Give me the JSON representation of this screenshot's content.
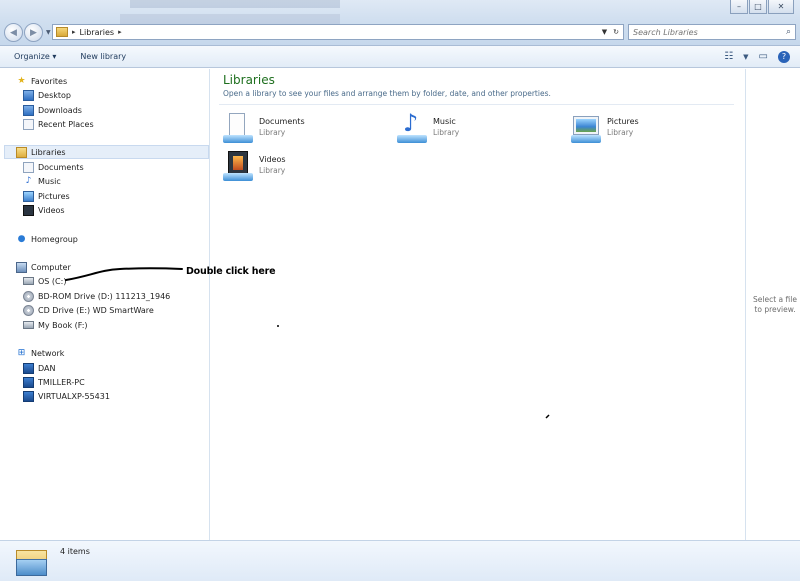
{
  "address_bar": {
    "breadcrumb": [
      "Libraries"
    ],
    "search_placeholder": "Search Libraries"
  },
  "toolbar": {
    "organize_label": "Organize",
    "new_library_label": "New library"
  },
  "navigation": {
    "favorites": {
      "label": "Favorites",
      "items": [
        "Desktop",
        "Downloads",
        "Recent Places"
      ]
    },
    "libraries": {
      "label": "Libraries",
      "items": [
        "Documents",
        "Music",
        "Pictures",
        "Videos"
      ]
    },
    "homegroup": {
      "label": "Homegroup"
    },
    "computer": {
      "label": "Computer",
      "items": [
        "OS (C:)",
        "BD-ROM Drive (D:) 111213_1946",
        "CD Drive (E:) WD SmartWare",
        "My Book (F:)"
      ]
    },
    "network": {
      "label": "Network",
      "items": [
        "DAN",
        "TMILLER-PC",
        "VIRTUALXP-55431"
      ]
    }
  },
  "content": {
    "title": "Libraries",
    "subtitle": "Open a library to see your files and arrange them by folder, date, and other properties.",
    "libraries": [
      {
        "name": "Documents",
        "kind": "Library",
        "icon": "documents-library-icon"
      },
      {
        "name": "Music",
        "kind": "Library",
        "icon": "music-library-icon"
      },
      {
        "name": "Pictures",
        "kind": "Library",
        "icon": "pictures-library-icon"
      },
      {
        "name": "Videos",
        "kind": "Library",
        "icon": "videos-library-icon"
      }
    ]
  },
  "preview": {
    "message": "Select a file to preview."
  },
  "status": {
    "item_count": "4 items"
  },
  "annotation": {
    "text": "Double click here"
  },
  "colors": {
    "title_green": "#1e6f1e",
    "selection": "#e5eef9",
    "toolbar_text": "#1e395b"
  }
}
